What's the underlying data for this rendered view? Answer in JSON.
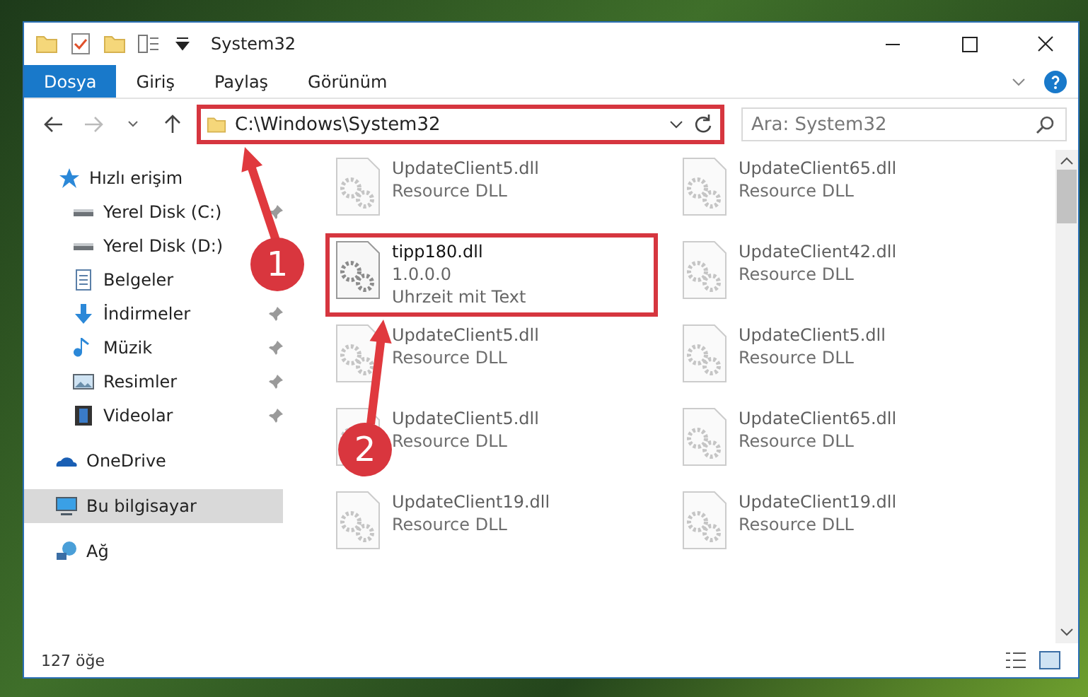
{
  "window": {
    "title": "System32"
  },
  "ribbon_tabs": [
    {
      "label": "Dosya",
      "selected": true
    },
    {
      "label": "Giriş",
      "selected": false
    },
    {
      "label": "Paylaş",
      "selected": false
    },
    {
      "label": "Görünüm",
      "selected": false
    }
  ],
  "address": {
    "path": "C:\\Windows\\System32",
    "highlighted": true
  },
  "search": {
    "placeholder": "Ara: System32"
  },
  "nav": [
    {
      "label": "Hızlı erişim",
      "kind": "star",
      "selected": false,
      "children": [
        {
          "label": "Yerel Disk (C:)",
          "kind": "drive",
          "pinned": true,
          "selected": false
        },
        {
          "label": "Yerel Disk (D:)",
          "kind": "drive",
          "pinned": false,
          "selected": false
        },
        {
          "label": "Belgeler",
          "kind": "doc",
          "pinned": false,
          "selected": false
        },
        {
          "label": "İndirmeler",
          "kind": "download",
          "pinned": true,
          "selected": false
        },
        {
          "label": "Müzik",
          "kind": "music",
          "pinned": true,
          "selected": false
        },
        {
          "label": "Resimler",
          "kind": "picture",
          "pinned": true,
          "selected": false
        },
        {
          "label": "Videolar",
          "kind": "video",
          "pinned": true,
          "selected": false
        }
      ]
    },
    {
      "label": "OneDrive",
      "kind": "cloud",
      "selected": false
    },
    {
      "label": "Bu bilgisayar",
      "kind": "pc",
      "selected": true
    },
    {
      "label": "Ağ",
      "kind": "network",
      "selected": false
    }
  ],
  "files": [
    {
      "name": "UpdateClient5.dll",
      "lines": [
        "Resource DLL"
      ],
      "blurred": true,
      "highlighted": false
    },
    {
      "name": "UpdateClient65.dll",
      "lines": [
        "Resource DLL"
      ],
      "blurred": true,
      "highlighted": false
    },
    {
      "name": "tipp180.dll",
      "lines": [
        "1.0.0.0",
        "Uhrzeit mit Text"
      ],
      "blurred": false,
      "highlighted": true
    },
    {
      "name": "UpdateClient42.dll",
      "lines": [
        "Resource DLL"
      ],
      "blurred": true,
      "highlighted": false
    },
    {
      "name": "UpdateClient5.dll",
      "lines": [
        "Resource DLL"
      ],
      "blurred": true,
      "highlighted": false
    },
    {
      "name": "UpdateClient5.dll",
      "lines": [
        "Resource DLL"
      ],
      "blurred": true,
      "highlighted": false
    },
    {
      "name": "UpdateClient5.dll",
      "lines": [
        "Resource DLL"
      ],
      "blurred": true,
      "highlighted": false
    },
    {
      "name": "UpdateClient65.dll",
      "lines": [
        "Resource DLL"
      ],
      "blurred": true,
      "highlighted": false
    },
    {
      "name": "UpdateClient19.dll",
      "lines": [
        "Resource DLL"
      ],
      "blurred": true,
      "highlighted": false
    },
    {
      "name": "UpdateClient19.dll",
      "lines": [
        "Resource DLL"
      ],
      "blurred": true,
      "highlighted": false
    }
  ],
  "status_bar": {
    "count": "127 öğe"
  },
  "callouts": [
    {
      "number": "1"
    },
    {
      "number": "2"
    }
  ]
}
